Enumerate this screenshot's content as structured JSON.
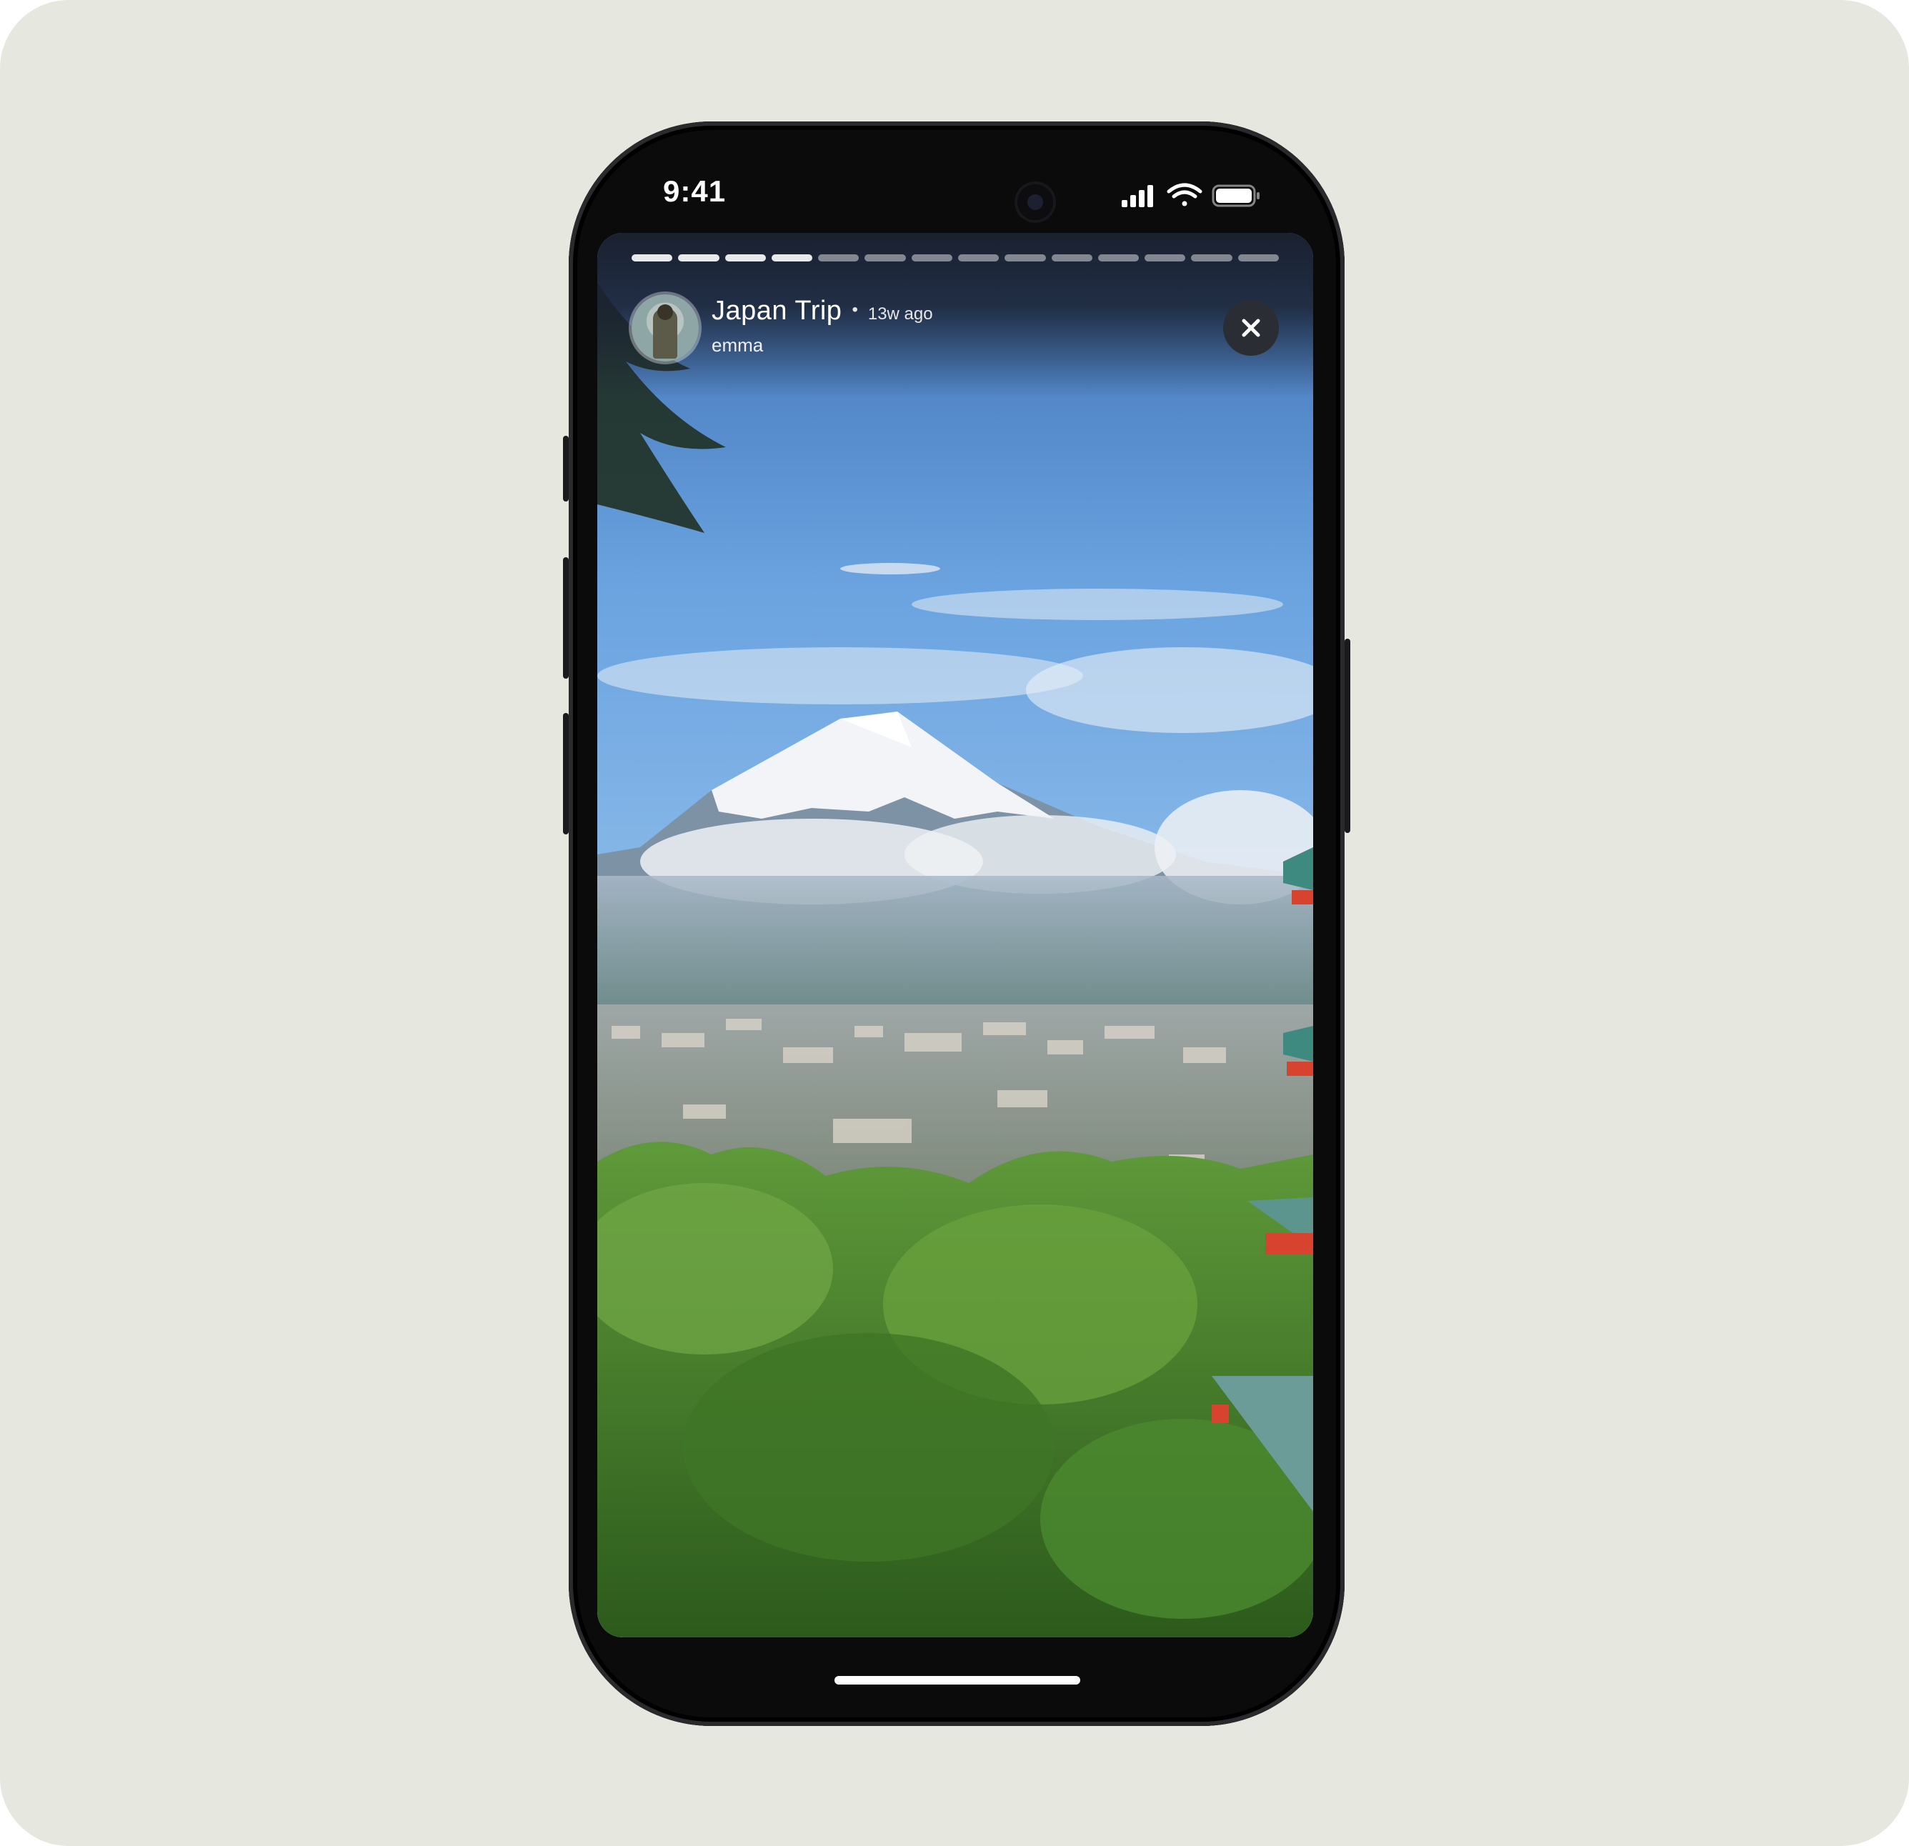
{
  "status_bar": {
    "time": "9:41"
  },
  "story": {
    "title": "Japan Trip",
    "separator": "•",
    "time_ago": "13w ago",
    "username": "emma",
    "progress_segments": 14,
    "progress_seen": 4
  },
  "icons": [
    "signal-icon",
    "wifi-icon",
    "battery-icon",
    "close-icon"
  ],
  "photo": {
    "subject": "mountain-landscape-photo"
  }
}
